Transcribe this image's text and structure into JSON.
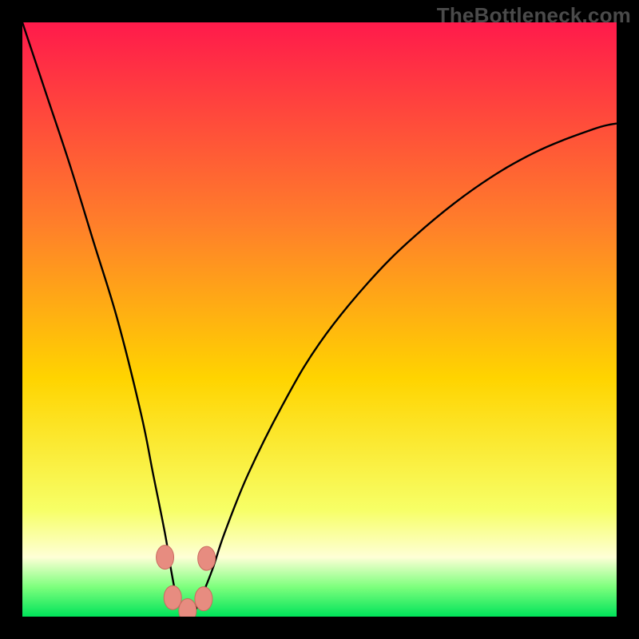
{
  "watermark": "TheBottleneck.com",
  "colors": {
    "frame": "#000000",
    "grad_top": "#ff1a4b",
    "grad_mid_upper": "#ff7f2a",
    "grad_mid": "#ffd400",
    "grad_lower": "#f7ff66",
    "grad_pale": "#feffd6",
    "grad_green_light": "#7dff7d",
    "grad_green": "#00e35a",
    "curve": "#000000",
    "marker_fill": "#e78c80",
    "marker_stroke": "#c96b5f"
  },
  "chart_data": {
    "type": "line",
    "title": "",
    "xlabel": "",
    "ylabel": "",
    "xlim": [
      0,
      100
    ],
    "ylim": [
      0,
      100
    ],
    "note": "No axes or tick labels shown; values estimated from pixel positions. y is 'bottleneck %' style metric (0 at bottom/green → 100 at top/red). x is an unlabeled parameter.",
    "series": [
      {
        "name": "bottleneck-curve",
        "x": [
          0,
          4,
          8,
          12,
          16,
          20,
          22,
          24,
          25,
          26,
          27,
          28,
          29,
          30,
          32,
          34,
          38,
          44,
          50,
          58,
          66,
          76,
          86,
          96,
          100
        ],
        "y": [
          100,
          88,
          76,
          63,
          50,
          34,
          24,
          14,
          8,
          3,
          1,
          0.5,
          1,
          3,
          8,
          14,
          24,
          36,
          46,
          56,
          64,
          72,
          78,
          82,
          83
        ]
      }
    ],
    "markers": [
      {
        "x": 24.0,
        "y": 10.0
      },
      {
        "x": 25.3,
        "y": 3.2
      },
      {
        "x": 27.8,
        "y": 1.0
      },
      {
        "x": 30.5,
        "y": 3.0
      },
      {
        "x": 31.0,
        "y": 9.8
      }
    ],
    "gradient_stops_pct_from_top": [
      {
        "pct": 0,
        "color": "grad_top"
      },
      {
        "pct": 34,
        "color": "grad_mid_upper"
      },
      {
        "pct": 60,
        "color": "grad_mid"
      },
      {
        "pct": 82,
        "color": "grad_lower"
      },
      {
        "pct": 90,
        "color": "grad_pale"
      },
      {
        "pct": 95,
        "color": "grad_green_light"
      },
      {
        "pct": 100,
        "color": "grad_green"
      }
    ]
  }
}
